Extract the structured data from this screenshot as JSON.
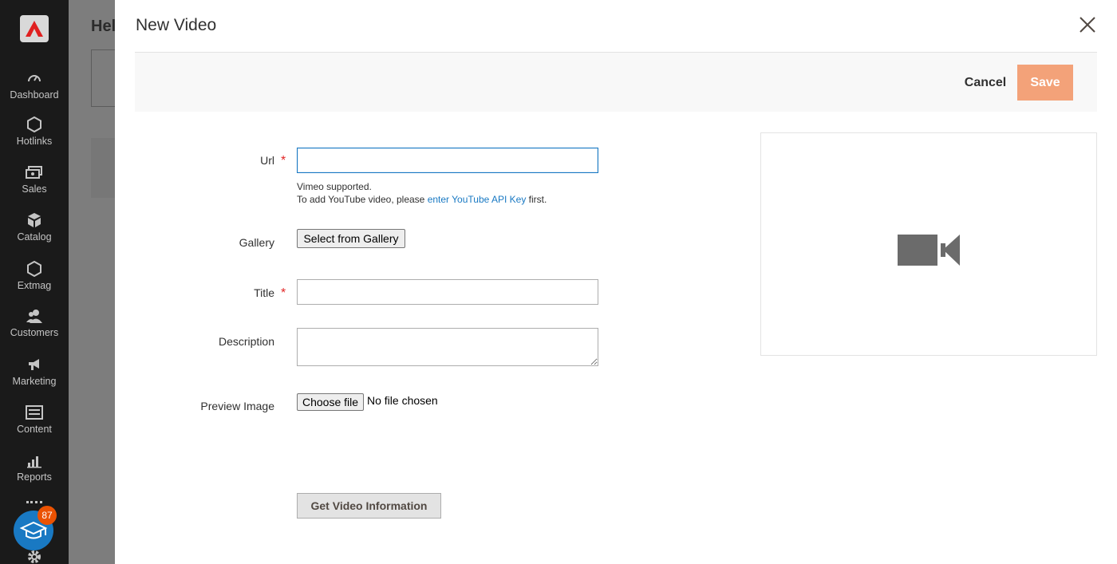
{
  "sidebar": {
    "items": [
      {
        "label": "Dashboard",
        "icon": "dashboard-icon"
      },
      {
        "label": "Hotlinks",
        "icon": "hexagon-icon"
      },
      {
        "label": "Sales",
        "icon": "money-icon"
      },
      {
        "label": "Catalog",
        "icon": "cube-icon"
      },
      {
        "label": "Extmag",
        "icon": "hexagon-icon"
      },
      {
        "label": "Customers",
        "icon": "users-icon"
      },
      {
        "label": "Marketing",
        "icon": "megaphone-icon"
      },
      {
        "label": "Content",
        "icon": "layout-icon"
      },
      {
        "label": "Reports",
        "icon": "bar-chart-icon"
      }
    ],
    "notification_count": "87"
  },
  "background": {
    "title": "Hel"
  },
  "modal": {
    "title": "New Video",
    "cancel_label": "Cancel",
    "save_label": "Save",
    "url_label": "Url",
    "url_note_line1": "Vimeo supported.",
    "url_note_prefix": "To add YouTube video, please ",
    "url_note_link": "enter YouTube API Key",
    "url_note_suffix": " first.",
    "gallery_label": "Gallery",
    "gallery_button": "Select from Gallery",
    "title_label": "Title",
    "description_label": "Description",
    "preview_label": "Preview Image",
    "choose_file_button": "Choose file",
    "no_file_text": "No file chosen",
    "get_info_button": "Get Video Information"
  },
  "colors": {
    "accent": "#1979c3",
    "save_disabled": "#f3a279",
    "required": "#e22626"
  }
}
